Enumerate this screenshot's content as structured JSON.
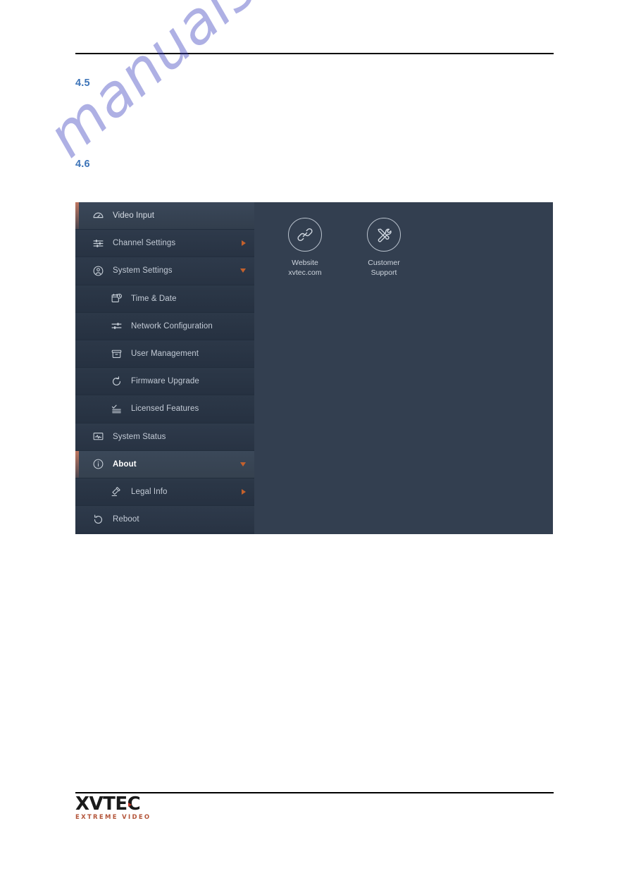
{
  "document": {
    "headings": [
      {
        "number": "4.5"
      },
      {
        "number": "4.6"
      }
    ],
    "footer": {
      "logo_text": "XVTEC",
      "logo_tagline": "EXTREME VIDEO"
    },
    "watermark": "manualshive.com"
  },
  "app": {
    "sidebar": {
      "items": [
        {
          "label": "Video Input",
          "icon": "gauge-icon",
          "level": 1,
          "state": "highlight",
          "caret": "none"
        },
        {
          "label": "Channel Settings",
          "icon": "sliders-icon",
          "level": 1,
          "state": "normal",
          "caret": "right"
        },
        {
          "label": "System Settings",
          "icon": "user-circle-icon",
          "level": 1,
          "state": "normal",
          "caret": "down"
        },
        {
          "label": "Time & Date",
          "icon": "calendar-clock-icon",
          "level": 2,
          "state": "normal",
          "caret": "none"
        },
        {
          "label": "Network Configuration",
          "icon": "network-sliders-icon",
          "level": 2,
          "state": "normal",
          "caret": "none"
        },
        {
          "label": "User Management",
          "icon": "archive-box-icon",
          "level": 2,
          "state": "normal",
          "caret": "none"
        },
        {
          "label": "Firmware Upgrade",
          "icon": "refresh-icon",
          "level": 2,
          "state": "normal",
          "caret": "none"
        },
        {
          "label": "Licensed Features",
          "icon": "checklist-icon",
          "level": 2,
          "state": "normal",
          "caret": "none"
        },
        {
          "label": "System Status",
          "icon": "monitor-pulse-icon",
          "level": 1,
          "state": "normal",
          "caret": "none"
        },
        {
          "label": "About",
          "icon": "info-circle-icon",
          "level": 1,
          "state": "active",
          "caret": "down"
        },
        {
          "label": "Legal Info",
          "icon": "gavel-icon",
          "level": 2,
          "state": "normal",
          "caret": "right"
        },
        {
          "label": "Reboot",
          "icon": "power-restart-icon",
          "level": 1,
          "state": "normal",
          "caret": "none"
        }
      ]
    },
    "content": {
      "shortcuts": [
        {
          "icon": "link-chain-icon",
          "label": "Website\nxvtec.com"
        },
        {
          "icon": "tools-icon",
          "label": "Customer\nSupport"
        }
      ]
    }
  },
  "colors": {
    "heading_blue": "#3d74b8",
    "accent_orange": "#c4612c",
    "sidebar_bg": "#2a3647",
    "content_bg": "#333f50",
    "logo_red": "#b4563b"
  }
}
